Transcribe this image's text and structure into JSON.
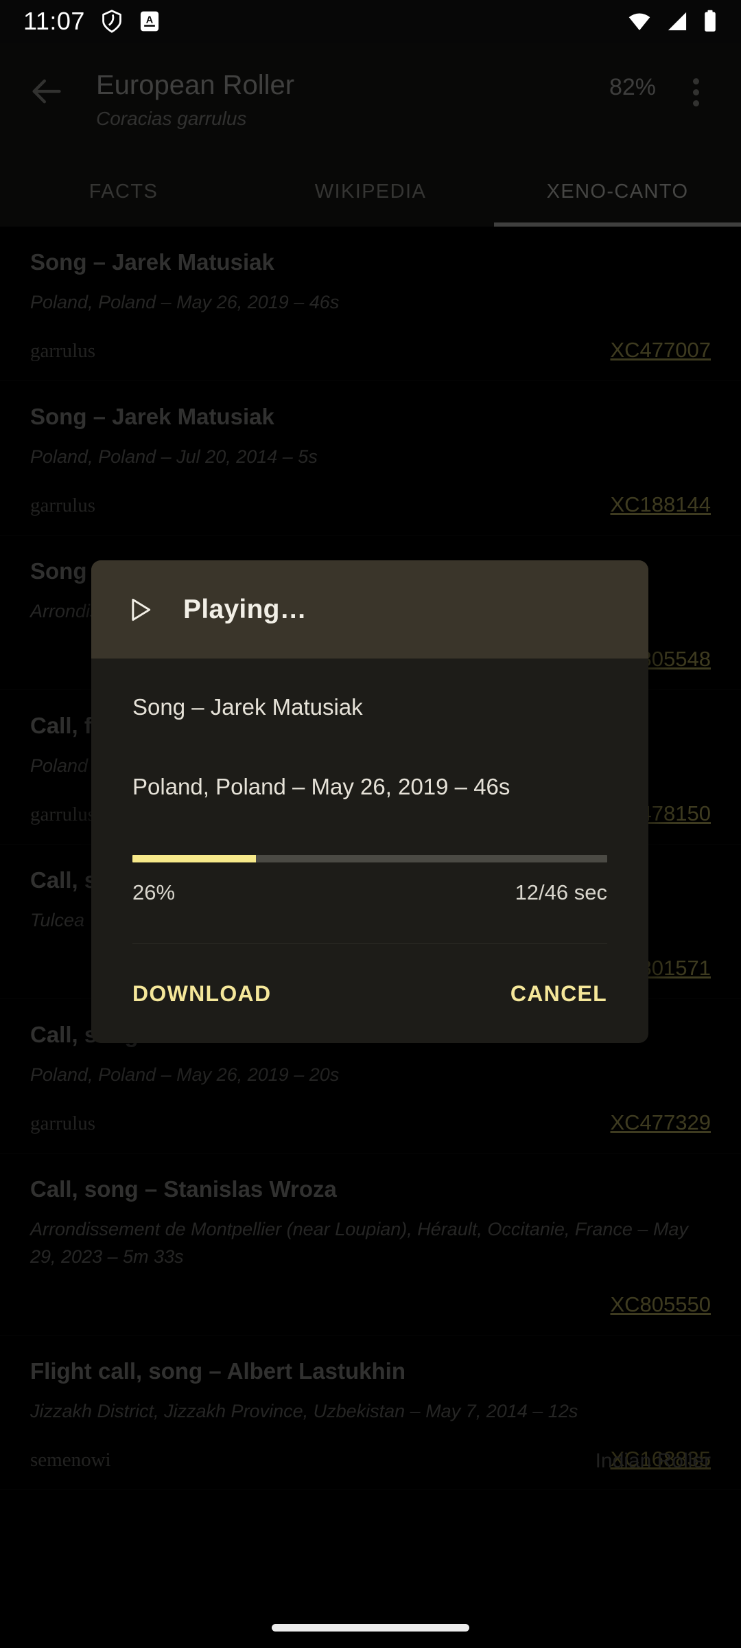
{
  "status_bar": {
    "time": "11:07",
    "left_icons": [
      "shield-icon",
      "app-notification-icon"
    ],
    "right_icons": [
      "wifi-icon",
      "cellular-signal-icon",
      "battery-icon"
    ]
  },
  "app_bar": {
    "back_icon": "back-arrow-icon",
    "title": "European Roller",
    "subtitle": "Coracias garrulus",
    "match_percent": "82%",
    "overflow_icon": "overflow-menu-icon"
  },
  "tabs": [
    {
      "label": "FACTS",
      "active": false
    },
    {
      "label": "WIKIPEDIA",
      "active": false
    },
    {
      "label": "XENO-CANTO",
      "active": true
    }
  ],
  "recordings": [
    {
      "title": "Song – Jarek Matusiak",
      "meta": "Poland, Poland – May 26, 2019 – 46s",
      "subspecies": "garrulus",
      "xc_id": "XC477007"
    },
    {
      "title": "Song – Jarek Matusiak",
      "meta": "Poland, Poland – Jul 20, 2014 – 5s",
      "subspecies": "garrulus",
      "xc_id": "XC188144"
    },
    {
      "title": "Song",
      "meta": "Arrondissement de Montpellier, Hérault, Occitanie, France – May 29, 2023",
      "subspecies": "",
      "xc_id": "XC805548"
    },
    {
      "title": "Call, f",
      "meta": "Poland",
      "subspecies": "garrulus",
      "xc_id": "XC478150"
    },
    {
      "title": "Call, s",
      "meta": "Tulcea",
      "subspecies": "",
      "xc_id": "XC801571"
    },
    {
      "title": "Call, song – Jarek Matusiak",
      "meta": "Poland, Poland – May 26, 2019 – 20s",
      "subspecies": "garrulus",
      "xc_id": "XC477329"
    },
    {
      "title": "Call, song – Stanislas Wroza",
      "meta": "Arrondissement de Montpellier (near  Loupian), Hérault, Occitanie, France – May 29, 2023 – 5m 33s",
      "subspecies": "",
      "xc_id": "XC805550"
    },
    {
      "title": "Flight call, song – Albert Lastukhin",
      "meta": "Jizzakh District, Jizzakh Province, Uzbekistan – May 7, 2014 – 12s",
      "subspecies": "semenowi",
      "xc_id": "XC168835",
      "alt_name": "Indian Roller"
    }
  ],
  "dialog": {
    "play_icon": "play-triangle-icon",
    "title": "Playing…",
    "track_name": "Song – Jarek Matusiak",
    "track_meta": "Poland, Poland – May 26, 2019 – 46s",
    "progress_percent": "26%",
    "progress_value": 26,
    "time_label": "12/46 sec",
    "download_label": "DOWNLOAD",
    "cancel_label": "CANCEL",
    "accent_color": "#f5e79a",
    "header_color": "#3a352a",
    "surface_color": "#1d1c18"
  },
  "nav_bar": {
    "handle": "home-gesture-handle"
  }
}
